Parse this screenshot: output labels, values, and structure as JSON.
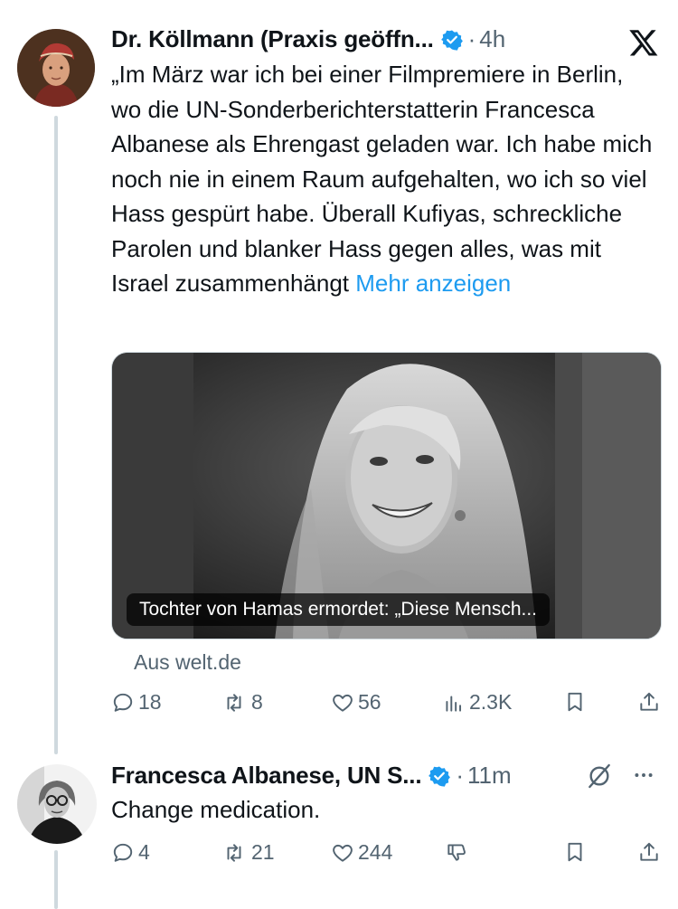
{
  "tweet1": {
    "author": "Dr. Köllmann (Praxis geöffn...",
    "separator": "·",
    "time": "4h",
    "text": "„Im März war ich bei einer Filmpremiere in Berlin, wo die UN-Sonderberichterstatterin Francesca Albanese als Ehrengast geladen war. Ich habe mich noch nie in einem Raum aufgehalten, wo ich so viel Hass gespürt habe. Überall Kufiyas, schreckliche Parolen und blanker Hass gegen alles, was mit Israel zusammenhängt",
    "more_label": "Mehr anzeigen",
    "card_caption": "Tochter von Hamas ermordet: „Diese Mensch...",
    "card_source": "Aus welt.de",
    "replies": "18",
    "reposts": "8",
    "likes": "56",
    "views": "2.3K"
  },
  "tweet2": {
    "author": "Francesca Albanese, UN S...",
    "separator": "·",
    "time": "11m",
    "text": "Change medication.",
    "replies": "4",
    "reposts": "21",
    "likes": "244"
  },
  "icons": {
    "verified_color": "#1d9bf0",
    "link_color": "#1d9bf0",
    "muted_color": "#536471"
  }
}
